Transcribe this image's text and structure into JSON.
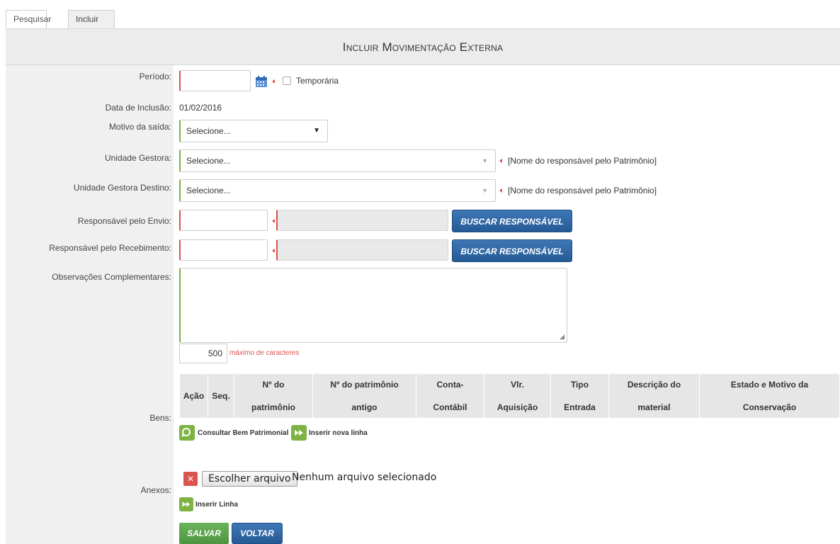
{
  "tabs": [
    "Pesquisar",
    "Incluir"
  ],
  "header": {
    "title": "Incluir Movimentação Externa"
  },
  "labels": {
    "periodo": "Período:",
    "data_inclusao": "Data de Inclusão:",
    "motivo": "Motivo da saída:",
    "unidade_gestora": "Unidade Gestora:",
    "unidade_destino": "Unidade Gestora Destino:",
    "resp_envio": "Responsável pelo Envio:",
    "resp_receb": "Responsável pelo Recebimento:",
    "observacoes": "Observações Complementares:",
    "bens": "Bens:",
    "anexos": "Anexos:"
  },
  "form": {
    "periodo_value": "",
    "temporaria_label": "Temporária",
    "data_inclusao_value": "01/02/2016",
    "motivo_value": "Selecione...",
    "unidade_gestora_value": "Selecione...",
    "unidade_gestora_hint": "[Nome do responsável pelo Patrimônio]",
    "unidade_destino_value": "Selecione...",
    "unidade_destino_hint": "[Nome do responsável pelo Patrimônio]",
    "buscar_envio": "BUSCAR RESPONSÁVEL",
    "buscar_receb": "BUSCAR RESPONSÁVEL",
    "char_count": "500",
    "char_hint": "máximo de caracteres"
  },
  "bens_table": {
    "columns": [
      {
        "line1": "Ação",
        "line2": ""
      },
      {
        "line1": "Seq.",
        "line2": ""
      },
      {
        "line1": "Nº do",
        "line2": "patrimônio"
      },
      {
        "line1": "Nº do patrimônio",
        "line2": "antigo"
      },
      {
        "line1": "Conta-",
        "line2": "Contábil"
      },
      {
        "line1": "Vlr.",
        "line2": "Aquisição"
      },
      {
        "line1": "Tipo",
        "line2": "Entrada"
      },
      {
        "line1": "Descrição do",
        "line2": "material"
      },
      {
        "line1": "Estado e Motivo da",
        "line2": "Conservação"
      }
    ],
    "consultar_label": "Consultar Bem Patrimonial",
    "inserir_label": "Inserir nova linha"
  },
  "anexos": {
    "escolher_label": "Escolher arquivo",
    "nenhum_label": "Nenhum arquivo selecionado",
    "inserir_linha_label": "Inserir Linha"
  },
  "actions": {
    "salvar": "SALVAR",
    "voltar": "VOLTAR"
  },
  "colors": {
    "required": "#d9534f",
    "ok": "#7cb342",
    "primary": "#2e65a3",
    "success": "#5ca34c"
  }
}
